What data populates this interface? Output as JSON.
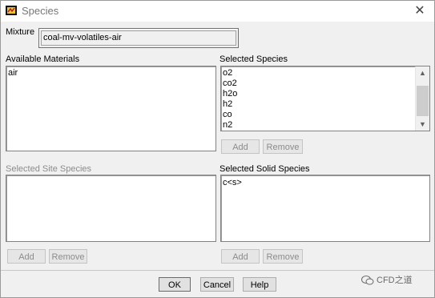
{
  "window": {
    "title": "Species"
  },
  "mixture": {
    "label": "Mixture",
    "value": "coal-mv-volatiles-air"
  },
  "available_materials": {
    "label": "Available Materials",
    "items": [
      "air"
    ]
  },
  "selected_species": {
    "label": "Selected Species",
    "items": [
      "o2",
      "co2",
      "h2o",
      "h2",
      "co",
      "n2"
    ],
    "add_label": "Add",
    "remove_label": "Remove"
  },
  "selected_site_species": {
    "label": "Selected Site Species",
    "items": [],
    "add_label": "Add",
    "remove_label": "Remove"
  },
  "selected_solid_species": {
    "label": "Selected Solid Species",
    "items": [
      "c<s>"
    ],
    "add_label": "Add",
    "remove_label": "Remove"
  },
  "footer": {
    "ok_label": "OK",
    "cancel_label": "Cancel",
    "help_label": "Help"
  },
  "watermark": {
    "text": "CFD之道"
  },
  "icons": {
    "app": "fluent-app-icon",
    "close": "close-icon",
    "watermark": "wechat-icon"
  }
}
